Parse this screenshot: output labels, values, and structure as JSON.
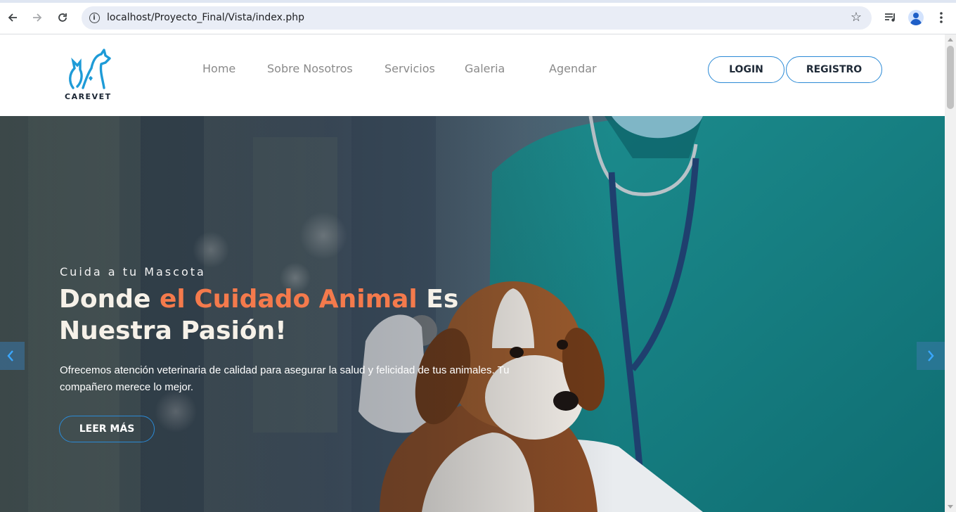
{
  "browser": {
    "url": "localhost/Proyecto_Final/Vista/index.php",
    "icons": [
      "back-icon",
      "forward-icon",
      "reload-icon",
      "site-info-icon",
      "bookmark-star-icon",
      "media-controls-icon",
      "profile-avatar-icon",
      "more-vert-icon"
    ]
  },
  "header": {
    "logo_text": "CAREVET",
    "menu": [
      {
        "label": "Home"
      },
      {
        "label": "Sobre Nosotros"
      },
      {
        "label": "Servicios"
      },
      {
        "label": "Galeria"
      },
      {
        "label": "Agendar"
      }
    ],
    "login_label": "LOGIN",
    "register_label": "REGISTRO"
  },
  "hero": {
    "subtitle": "Cuida a tu Mascota",
    "title_part1": "Donde ",
    "title_accent": "el Cuidado Animal",
    "title_part2": " Es Nuestra Pasión!",
    "description": "Ofrecemos atención veterinaria de calidad para asegurar la salud y felicidad de tus animales. Tu compañero merece lo mejor.",
    "button_label": "LEER MÁS",
    "prev_icon": "chevron-left-icon",
    "next_icon": "chevron-right-icon"
  },
  "colors": {
    "accent_orange": "#f47a4c",
    "brand_blue": "#2b8ad6",
    "logo_blue": "#1e9bd7"
  }
}
